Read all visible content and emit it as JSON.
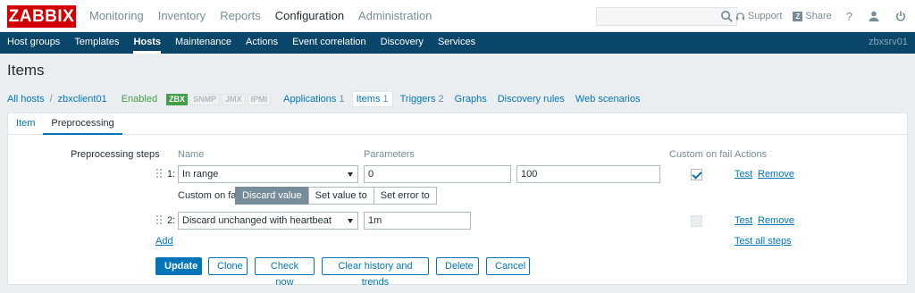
{
  "brand": {
    "logo_text": "ZABBIX",
    "color": "#d40000"
  },
  "main_menu": [
    "Monitoring",
    "Inventory",
    "Reports",
    "Configuration",
    "Administration"
  ],
  "main_menu_active": "Configuration",
  "top_links": {
    "support": "Support",
    "share": "Share",
    "help": "?"
  },
  "sub_menu": [
    "Host groups",
    "Templates",
    "Hosts",
    "Maintenance",
    "Actions",
    "Event correlation",
    "Discovery",
    "Services"
  ],
  "sub_menu_active": "Hosts",
  "server_name": "zbxsrv01",
  "page_title": "Items",
  "breadcrumbs": {
    "all_hosts": "All hosts",
    "separator": "/",
    "host": "zbxclient01",
    "status": "Enabled",
    "availability": [
      "ZBX",
      "SNMP",
      "JMX",
      "IPMI"
    ],
    "links": [
      {
        "label": "Applications",
        "count": "1"
      },
      {
        "label": "Items",
        "count": "1"
      },
      {
        "label": "Triggers",
        "count": "2"
      },
      {
        "label": "Graphs",
        "count": ""
      },
      {
        "label": "Discovery rules",
        "count": ""
      },
      {
        "label": "Web scenarios",
        "count": ""
      }
    ]
  },
  "tabs": [
    "Item",
    "Preprocessing"
  ],
  "active_tab": "Preprocessing",
  "form": {
    "section_label": "Preprocessing steps",
    "headers": {
      "name": "Name",
      "parameters": "Parameters",
      "custom_on_fail": "Custom on fail",
      "actions": "Actions"
    },
    "steps": [
      {
        "num": "1:",
        "name": "In range",
        "param1": "0",
        "param2": "100",
        "custom_on_fail": true,
        "test": "Test",
        "remove": "Remove"
      },
      {
        "num": "2:",
        "name": "Discard unchanged with heartbeat",
        "param1": "1m",
        "custom_on_fail": false,
        "test": "Test",
        "remove": "Remove"
      }
    ],
    "on_fail": {
      "label": "Custom on fail",
      "options": [
        "Discard value",
        "Set value to",
        "Set error to"
      ],
      "selected": "Discard value"
    },
    "add": "Add",
    "test_all": "Test all steps"
  },
  "buttons": {
    "update": "Update",
    "clone": "Clone",
    "check_now": "Check now",
    "clear": "Clear history and trends",
    "delete": "Delete",
    "cancel": "Cancel"
  }
}
